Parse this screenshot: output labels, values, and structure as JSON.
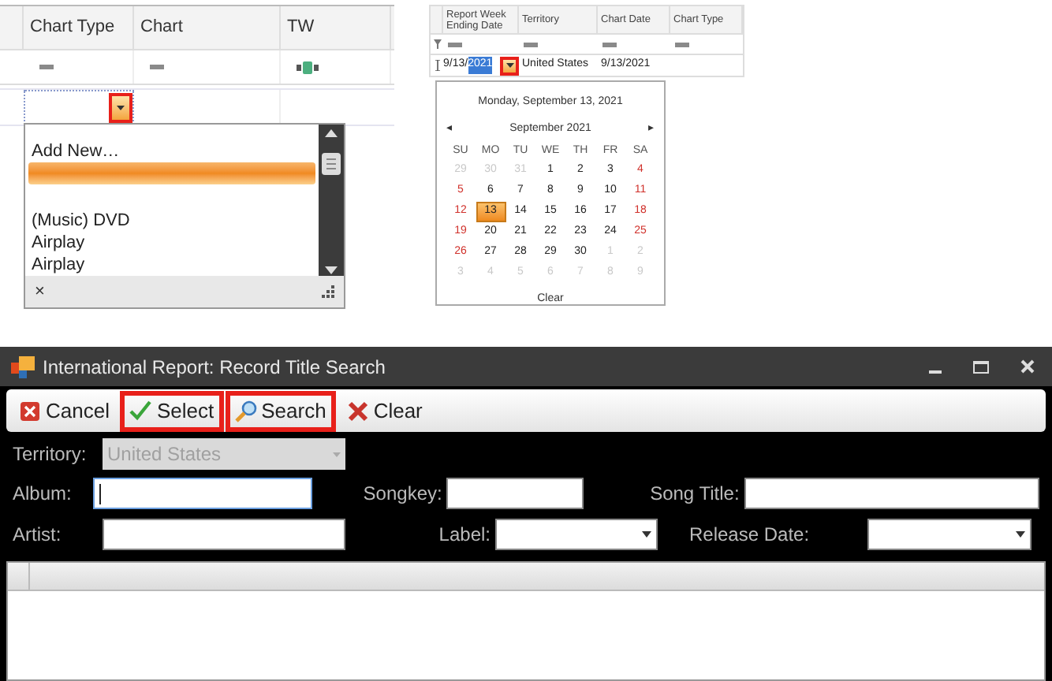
{
  "chart_grid": {
    "columns": [
      {
        "label": "Chart Type",
        "kind": "equals"
      },
      {
        "label": "Chart",
        "kind": "equals"
      },
      {
        "label": "TW",
        "kind": "text"
      }
    ],
    "dropdown_button": {
      "highlighted": true
    },
    "dropdown": {
      "items": [
        {
          "label": "Add New…",
          "selected": false
        },
        {
          "selected": true
        },
        {
          "label": "(Music) DVD",
          "selected": false
        },
        {
          "label": "Airplay",
          "selected": false
        },
        {
          "label": "Airplay",
          "selected": false
        }
      ],
      "close": "×"
    }
  },
  "date_grid": {
    "columns": [
      "Report Week Ending Date",
      "Territory",
      "Chart Date",
      "Chart Type"
    ],
    "edit_row": {
      "date_prefix": "9/13/",
      "date_selected": "2021",
      "territory": "United States",
      "chart_date": "9/13/2021"
    },
    "dropdown_button": {
      "highlighted": true
    },
    "calendar": {
      "today": "Monday, September 13, 2021",
      "month": "September 2021",
      "prev": "◂",
      "next": "▸",
      "weekdays": [
        "SU",
        "MO",
        "TU",
        "WE",
        "TH",
        "FR",
        "SA"
      ],
      "days": [
        {
          "day": "29",
          "kind": "outside",
          "selected": false
        },
        {
          "day": "30",
          "kind": "outside",
          "selected": false
        },
        {
          "day": "31",
          "kind": "outside",
          "selected": false
        },
        {
          "day": "1",
          "kind": "current",
          "selected": false
        },
        {
          "day": "2",
          "kind": "current",
          "selected": false
        },
        {
          "day": "3",
          "kind": "current",
          "selected": false
        },
        {
          "day": "4",
          "kind": "current",
          "selected": false
        },
        {
          "day": "5",
          "kind": "current",
          "selected": false
        },
        {
          "day": "6",
          "kind": "current",
          "selected": false
        },
        {
          "day": "7",
          "kind": "current",
          "selected": false
        },
        {
          "day": "8",
          "kind": "current",
          "selected": false
        },
        {
          "day": "9",
          "kind": "current",
          "selected": false
        },
        {
          "day": "10",
          "kind": "current",
          "selected": false
        },
        {
          "day": "11",
          "kind": "current",
          "selected": false
        },
        {
          "day": "12",
          "kind": "current",
          "selected": false
        },
        {
          "day": "13",
          "kind": "current",
          "selected": true
        },
        {
          "day": "14",
          "kind": "current",
          "selected": false
        },
        {
          "day": "15",
          "kind": "current",
          "selected": false
        },
        {
          "day": "16",
          "kind": "current",
          "selected": false
        },
        {
          "day": "17",
          "kind": "current",
          "selected": false
        },
        {
          "day": "18",
          "kind": "current",
          "selected": false
        },
        {
          "day": "19",
          "kind": "current",
          "selected": false
        },
        {
          "day": "20",
          "kind": "current",
          "selected": false
        },
        {
          "day": "21",
          "kind": "current",
          "selected": false
        },
        {
          "day": "22",
          "kind": "current",
          "selected": false
        },
        {
          "day": "23",
          "kind": "current",
          "selected": false
        },
        {
          "day": "24",
          "kind": "current",
          "selected": false
        },
        {
          "day": "25",
          "kind": "current",
          "selected": false
        },
        {
          "day": "26",
          "kind": "current",
          "selected": false
        },
        {
          "day": "27",
          "kind": "current",
          "selected": false
        },
        {
          "day": "28",
          "kind": "current",
          "selected": false
        },
        {
          "day": "29",
          "kind": "current",
          "selected": false
        },
        {
          "day": "30",
          "kind": "current",
          "selected": false
        },
        {
          "day": "1",
          "kind": "outside",
          "selected": false
        },
        {
          "day": "2",
          "kind": "outside",
          "selected": false
        },
        {
          "day": "3",
          "kind": "outside",
          "selected": false
        },
        {
          "day": "4",
          "kind": "outside",
          "selected": false
        },
        {
          "day": "5",
          "kind": "outside",
          "selected": false
        },
        {
          "day": "6",
          "kind": "outside",
          "selected": false
        },
        {
          "day": "7",
          "kind": "outside",
          "selected": false
        },
        {
          "day": "8",
          "kind": "outside",
          "selected": false
        },
        {
          "day": "9",
          "kind": "outside",
          "selected": false
        }
      ],
      "clear": "Clear"
    }
  },
  "window": {
    "title": "International Report: Record Title Search",
    "toolbar": [
      {
        "label": "Cancel",
        "highlighted": false
      },
      {
        "label": "Select",
        "highlighted": true
      },
      {
        "label": "Search",
        "highlighted": true
      },
      {
        "label": "Clear",
        "highlighted": false
      }
    ],
    "territory": {
      "label": "Territory:",
      "value": "United States",
      "disabled": true
    },
    "fields": [
      {
        "label": "Album:",
        "kind": "text",
        "focused": true
      },
      {
        "label": "Songkey:",
        "kind": "text",
        "focused": false
      },
      {
        "label": "Song Title:",
        "kind": "text",
        "focused": false
      },
      {
        "label": "Artist:",
        "kind": "text",
        "focused": false
      },
      {
        "label": "Label:",
        "kind": "combo",
        "focused": false
      },
      {
        "label": "Release Date:",
        "kind": "combo",
        "focused": false
      }
    ]
  }
}
